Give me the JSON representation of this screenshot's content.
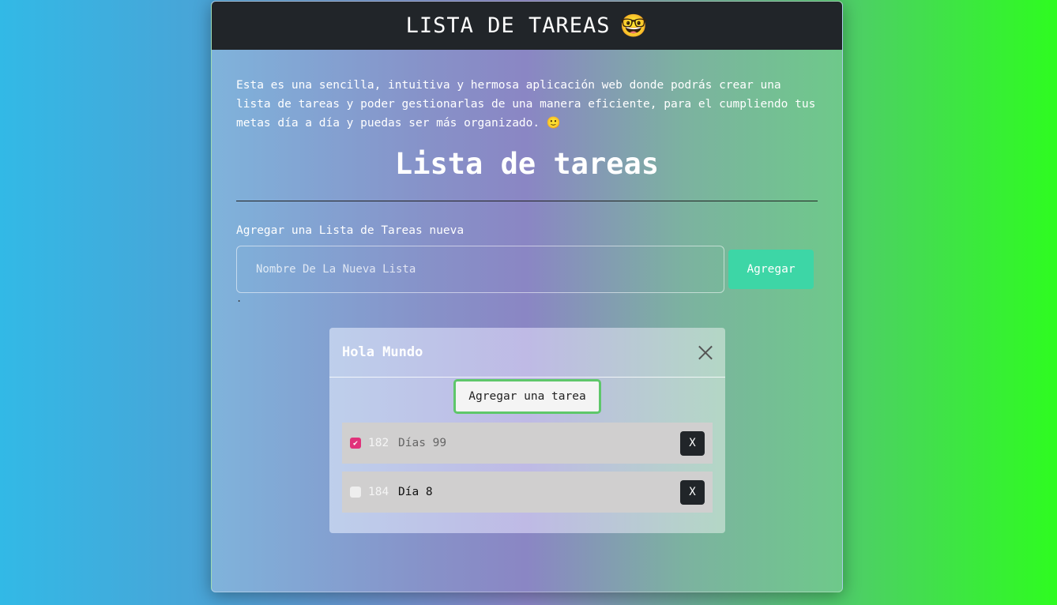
{
  "header": {
    "title": "LISTA DE TAREAS",
    "emoji": "🤓"
  },
  "intro": "Esta es una sencilla, intuitiva y hermosa aplicación web donde podrás crear una lista de tareas y poder gestionarlas de una manera eficiente, para el cumpliendo tus metas día a día y puedas ser más organizado. 🙂",
  "main": {
    "heading": "Lista de tareas",
    "new_list_label": "Agregar una Lista de Tareas nueva",
    "new_list_placeholder": "Nombre De La Nueva Lista",
    "add_button": "Agregar",
    "dot": "."
  },
  "list": {
    "title": "Hola Mundo",
    "add_task_button": "Agregar una tarea",
    "tasks": [
      {
        "id": "182",
        "text": "Días 99",
        "checked": true,
        "delete_label": "X"
      },
      {
        "id": "184",
        "text": "Día 8",
        "checked": false,
        "delete_label": "X"
      }
    ]
  },
  "colors": {
    "accent": "#3dd6a6",
    "checkbox_checked": "#e0327a",
    "header_bg": "#212529"
  }
}
